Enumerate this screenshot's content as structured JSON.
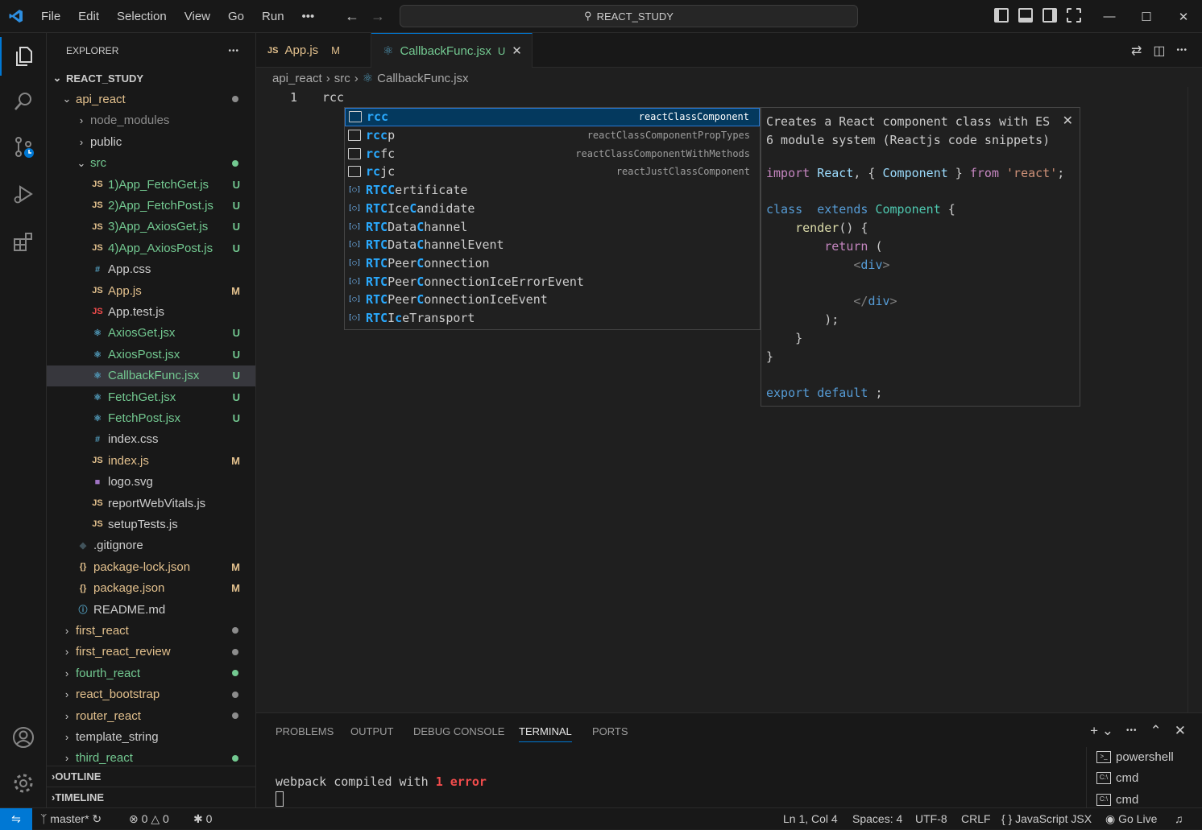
{
  "titlebar": {
    "menu": [
      "File",
      "Edit",
      "Selection",
      "View",
      "Go",
      "Run",
      "•••"
    ],
    "command_center": "REACT_STUDY"
  },
  "sidebar": {
    "title": "EXPLORER",
    "more": "•••",
    "root": "REACT_STUDY",
    "items": [
      {
        "label": "api_react",
        "type": "folder-open",
        "indent": 1,
        "color": "#e2c08d",
        "status": "",
        "dot": "#8c8c8c"
      },
      {
        "label": "node_modules",
        "type": "folder",
        "indent": 2,
        "color": "#8c8c8c",
        "status": "",
        "dot": ""
      },
      {
        "label": "public",
        "type": "folder",
        "indent": 2,
        "color": "#cccccc",
        "status": "",
        "dot": ""
      },
      {
        "label": "src",
        "type": "folder-open",
        "indent": 2,
        "color": "#73c991",
        "status": "",
        "dot": "#73c991"
      },
      {
        "label": "1)App_FetchGet.js",
        "type": "js",
        "indent": 3,
        "color": "#73c991",
        "status": "U",
        "dot": ""
      },
      {
        "label": "2)App_FetchPost.js",
        "type": "js",
        "indent": 3,
        "color": "#73c991",
        "status": "U",
        "dot": ""
      },
      {
        "label": "3)App_AxiosGet.js",
        "type": "js",
        "indent": 3,
        "color": "#73c991",
        "status": "U",
        "dot": ""
      },
      {
        "label": "4)App_AxiosPost.js",
        "type": "js",
        "indent": 3,
        "color": "#73c991",
        "status": "U",
        "dot": ""
      },
      {
        "label": "App.css",
        "type": "css",
        "indent": 3,
        "color": "#cccccc",
        "status": "",
        "dot": ""
      },
      {
        "label": "App.js",
        "type": "js",
        "indent": 3,
        "color": "#e2c08d",
        "status": "M",
        "dot": ""
      },
      {
        "label": "App.test.js",
        "type": "test",
        "indent": 3,
        "color": "#cccccc",
        "status": "",
        "dot": ""
      },
      {
        "label": "AxiosGet.jsx",
        "type": "jsx",
        "indent": 3,
        "color": "#73c991",
        "status": "U",
        "dot": ""
      },
      {
        "label": "AxiosPost.jsx",
        "type": "jsx",
        "indent": 3,
        "color": "#73c991",
        "status": "U",
        "dot": ""
      },
      {
        "label": "CallbackFunc.jsx",
        "type": "jsx",
        "indent": 3,
        "color": "#73c991",
        "status": "U",
        "dot": "",
        "selected": true
      },
      {
        "label": "FetchGet.jsx",
        "type": "jsx",
        "indent": 3,
        "color": "#73c991",
        "status": "U",
        "dot": ""
      },
      {
        "label": "FetchPost.jsx",
        "type": "jsx",
        "indent": 3,
        "color": "#73c991",
        "status": "U",
        "dot": ""
      },
      {
        "label": "index.css",
        "type": "css",
        "indent": 3,
        "color": "#cccccc",
        "status": "",
        "dot": ""
      },
      {
        "label": "index.js",
        "type": "js",
        "indent": 3,
        "color": "#e2c08d",
        "status": "M",
        "dot": ""
      },
      {
        "label": "logo.svg",
        "type": "svg",
        "indent": 3,
        "color": "#cccccc",
        "status": "",
        "dot": ""
      },
      {
        "label": "reportWebVitals.js",
        "type": "js",
        "indent": 3,
        "color": "#cccccc",
        "status": "",
        "dot": ""
      },
      {
        "label": "setupTests.js",
        "type": "js",
        "indent": 3,
        "color": "#cccccc",
        "status": "",
        "dot": ""
      },
      {
        "label": ".gitignore",
        "type": "git",
        "indent": 2,
        "color": "#cccccc",
        "status": "",
        "dot": ""
      },
      {
        "label": "package-lock.json",
        "type": "json",
        "indent": 2,
        "color": "#e2c08d",
        "status": "M",
        "dot": ""
      },
      {
        "label": "package.json",
        "type": "json",
        "indent": 2,
        "color": "#e2c08d",
        "status": "M",
        "dot": ""
      },
      {
        "label": "README.md",
        "type": "info",
        "indent": 2,
        "color": "#cccccc",
        "status": "",
        "dot": ""
      },
      {
        "label": "first_react",
        "type": "folder",
        "indent": 1,
        "color": "#e2c08d",
        "status": "",
        "dot": "#8c8c8c"
      },
      {
        "label": "first_react_review",
        "type": "folder",
        "indent": 1,
        "color": "#e2c08d",
        "status": "",
        "dot": "#8c8c8c"
      },
      {
        "label": "fourth_react",
        "type": "folder",
        "indent": 1,
        "color": "#73c991",
        "status": "",
        "dot": "#73c991"
      },
      {
        "label": "react_bootstrap",
        "type": "folder",
        "indent": 1,
        "color": "#e2c08d",
        "status": "",
        "dot": "#8c8c8c"
      },
      {
        "label": "router_react",
        "type": "folder",
        "indent": 1,
        "color": "#e2c08d",
        "status": "",
        "dot": "#8c8c8c"
      },
      {
        "label": "template_string",
        "type": "folder",
        "indent": 1,
        "color": "#cccccc",
        "status": "",
        "dot": ""
      },
      {
        "label": "third_react",
        "type": "folder",
        "indent": 1,
        "color": "#73c991",
        "status": "",
        "dot": "#73c991"
      }
    ],
    "outline": "OUTLINE",
    "timeline": "TIMELINE"
  },
  "tabs": [
    {
      "icon": "JS",
      "label": "App.js",
      "status": "M",
      "active": false
    },
    {
      "icon": "⚛",
      "label": "CallbackFunc.jsx",
      "status": "U",
      "active": true
    }
  ],
  "breadcrumb": [
    "api_react",
    "src",
    "CallbackFunc.jsx"
  ],
  "editor": {
    "line_number": "1",
    "code": "rcc"
  },
  "suggest": {
    "items": [
      {
        "hl": "rcc",
        "rest": "",
        "detail": "reactClassComponent",
        "kind": "snippet"
      },
      {
        "hl": "rcc",
        "rest": "p",
        "detail": "reactClassComponentPropTypes",
        "kind": "snippet"
      },
      {
        "hl": "rc",
        "rest": "fc",
        "detail": "reactClassComponentWithMethods",
        "kind": "snippet"
      },
      {
        "hl": "rc",
        "rest": "jc",
        "detail": "reactJustClassComponent",
        "kind": "snippet"
      },
      {
        "parts": [
          [
            "RTCC",
            true
          ],
          [
            "ertificate",
            false
          ]
        ],
        "kind": "variable"
      },
      {
        "parts": [
          [
            "RTC",
            true
          ],
          [
            "Ice",
            false
          ],
          [
            "C",
            true
          ],
          [
            "andidate",
            false
          ]
        ],
        "kind": "variable"
      },
      {
        "parts": [
          [
            "RTC",
            true
          ],
          [
            "Data",
            false
          ],
          [
            "C",
            true
          ],
          [
            "hannel",
            false
          ]
        ],
        "kind": "variable"
      },
      {
        "parts": [
          [
            "RTC",
            true
          ],
          [
            "Data",
            false
          ],
          [
            "C",
            true
          ],
          [
            "hannelEvent",
            false
          ]
        ],
        "kind": "variable"
      },
      {
        "parts": [
          [
            "RTC",
            true
          ],
          [
            "Peer",
            false
          ],
          [
            "C",
            true
          ],
          [
            "onnection",
            false
          ]
        ],
        "kind": "variable"
      },
      {
        "parts": [
          [
            "RTC",
            true
          ],
          [
            "Peer",
            false
          ],
          [
            "C",
            true
          ],
          [
            "onnectionIceErrorEvent",
            false
          ]
        ],
        "kind": "variable"
      },
      {
        "parts": [
          [
            "RTC",
            true
          ],
          [
            "Peer",
            false
          ],
          [
            "C",
            true
          ],
          [
            "onnectionIceEvent",
            false
          ]
        ],
        "kind": "variable"
      },
      {
        "parts": [
          [
            "RTC",
            true
          ],
          [
            "I",
            false
          ],
          [
            "c",
            true
          ],
          [
            "eTransport",
            false
          ]
        ],
        "kind": "variable"
      }
    ],
    "details": {
      "description": "Creates a React component class with ES 6 module system (Reactjs code snippets)",
      "close": "✕"
    }
  },
  "panel": {
    "tabs": [
      "PROBLEMS",
      "OUTPUT",
      "DEBUG CONSOLE",
      "TERMINAL",
      "PORTS"
    ],
    "active_tab": "TERMINAL",
    "terminal_text": "webpack compiled with ",
    "terminal_error": "1 error",
    "terminals": [
      "powershell",
      "cmd",
      "cmd"
    ]
  },
  "statusbar": {
    "branch": "master*",
    "errors": "0",
    "warnings": "0",
    "ports": "0",
    "position": "Ln 1, Col 4",
    "spaces": "Spaces: 4",
    "encoding": "UTF-8",
    "eol": "CRLF",
    "language": "JavaScript JSX",
    "golive": "Go Live"
  }
}
